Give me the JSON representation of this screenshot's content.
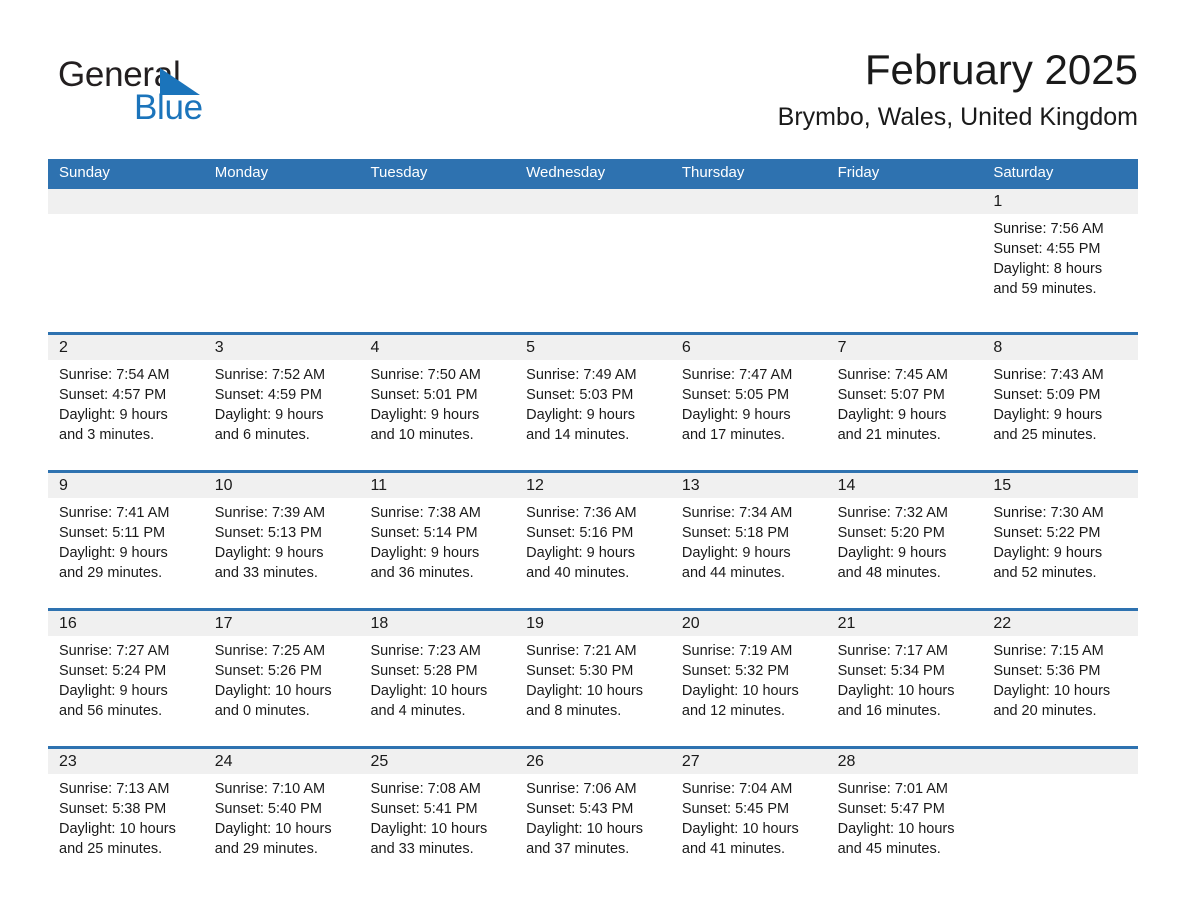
{
  "brand": {
    "name_part1": "General",
    "name_part2": "Blue",
    "logo_icon": "triangle-logo-icon",
    "accent_color": "#1b74bb"
  },
  "header": {
    "title": "February 2025",
    "subtitle": "Brymbo, Wales, United Kingdom"
  },
  "theme": {
    "header_blue": "#2e72b0",
    "datebar_gray": "#f0f0f0",
    "text_color": "#1a1a1a"
  },
  "weekdays": [
    "Sunday",
    "Monday",
    "Tuesday",
    "Wednesday",
    "Thursday",
    "Friday",
    "Saturday"
  ],
  "weeks": [
    {
      "days": [
        {
          "num": "",
          "sunrise": "",
          "sunset": "",
          "daylight1": "",
          "daylight2": ""
        },
        {
          "num": "",
          "sunrise": "",
          "sunset": "",
          "daylight1": "",
          "daylight2": ""
        },
        {
          "num": "",
          "sunrise": "",
          "sunset": "",
          "daylight1": "",
          "daylight2": ""
        },
        {
          "num": "",
          "sunrise": "",
          "sunset": "",
          "daylight1": "",
          "daylight2": ""
        },
        {
          "num": "",
          "sunrise": "",
          "sunset": "",
          "daylight1": "",
          "daylight2": ""
        },
        {
          "num": "",
          "sunrise": "",
          "sunset": "",
          "daylight1": "",
          "daylight2": ""
        },
        {
          "num": "1",
          "sunrise": "Sunrise: 7:56 AM",
          "sunset": "Sunset: 4:55 PM",
          "daylight1": "Daylight: 8 hours",
          "daylight2": "and 59 minutes."
        }
      ]
    },
    {
      "days": [
        {
          "num": "2",
          "sunrise": "Sunrise: 7:54 AM",
          "sunset": "Sunset: 4:57 PM",
          "daylight1": "Daylight: 9 hours",
          "daylight2": "and 3 minutes."
        },
        {
          "num": "3",
          "sunrise": "Sunrise: 7:52 AM",
          "sunset": "Sunset: 4:59 PM",
          "daylight1": "Daylight: 9 hours",
          "daylight2": "and 6 minutes."
        },
        {
          "num": "4",
          "sunrise": "Sunrise: 7:50 AM",
          "sunset": "Sunset: 5:01 PM",
          "daylight1": "Daylight: 9 hours",
          "daylight2": "and 10 minutes."
        },
        {
          "num": "5",
          "sunrise": "Sunrise: 7:49 AM",
          "sunset": "Sunset: 5:03 PM",
          "daylight1": "Daylight: 9 hours",
          "daylight2": "and 14 minutes."
        },
        {
          "num": "6",
          "sunrise": "Sunrise: 7:47 AM",
          "sunset": "Sunset: 5:05 PM",
          "daylight1": "Daylight: 9 hours",
          "daylight2": "and 17 minutes."
        },
        {
          "num": "7",
          "sunrise": "Sunrise: 7:45 AM",
          "sunset": "Sunset: 5:07 PM",
          "daylight1": "Daylight: 9 hours",
          "daylight2": "and 21 minutes."
        },
        {
          "num": "8",
          "sunrise": "Sunrise: 7:43 AM",
          "sunset": "Sunset: 5:09 PM",
          "daylight1": "Daylight: 9 hours",
          "daylight2": "and 25 minutes."
        }
      ]
    },
    {
      "days": [
        {
          "num": "9",
          "sunrise": "Sunrise: 7:41 AM",
          "sunset": "Sunset: 5:11 PM",
          "daylight1": "Daylight: 9 hours",
          "daylight2": "and 29 minutes."
        },
        {
          "num": "10",
          "sunrise": "Sunrise: 7:39 AM",
          "sunset": "Sunset: 5:13 PM",
          "daylight1": "Daylight: 9 hours",
          "daylight2": "and 33 minutes."
        },
        {
          "num": "11",
          "sunrise": "Sunrise: 7:38 AM",
          "sunset": "Sunset: 5:14 PM",
          "daylight1": "Daylight: 9 hours",
          "daylight2": "and 36 minutes."
        },
        {
          "num": "12",
          "sunrise": "Sunrise: 7:36 AM",
          "sunset": "Sunset: 5:16 PM",
          "daylight1": "Daylight: 9 hours",
          "daylight2": "and 40 minutes."
        },
        {
          "num": "13",
          "sunrise": "Sunrise: 7:34 AM",
          "sunset": "Sunset: 5:18 PM",
          "daylight1": "Daylight: 9 hours",
          "daylight2": "and 44 minutes."
        },
        {
          "num": "14",
          "sunrise": "Sunrise: 7:32 AM",
          "sunset": "Sunset: 5:20 PM",
          "daylight1": "Daylight: 9 hours",
          "daylight2": "and 48 minutes."
        },
        {
          "num": "15",
          "sunrise": "Sunrise: 7:30 AM",
          "sunset": "Sunset: 5:22 PM",
          "daylight1": "Daylight: 9 hours",
          "daylight2": "and 52 minutes."
        }
      ]
    },
    {
      "days": [
        {
          "num": "16",
          "sunrise": "Sunrise: 7:27 AM",
          "sunset": "Sunset: 5:24 PM",
          "daylight1": "Daylight: 9 hours",
          "daylight2": "and 56 minutes."
        },
        {
          "num": "17",
          "sunrise": "Sunrise: 7:25 AM",
          "sunset": "Sunset: 5:26 PM",
          "daylight1": "Daylight: 10 hours",
          "daylight2": "and 0 minutes."
        },
        {
          "num": "18",
          "sunrise": "Sunrise: 7:23 AM",
          "sunset": "Sunset: 5:28 PM",
          "daylight1": "Daylight: 10 hours",
          "daylight2": "and 4 minutes."
        },
        {
          "num": "19",
          "sunrise": "Sunrise: 7:21 AM",
          "sunset": "Sunset: 5:30 PM",
          "daylight1": "Daylight: 10 hours",
          "daylight2": "and 8 minutes."
        },
        {
          "num": "20",
          "sunrise": "Sunrise: 7:19 AM",
          "sunset": "Sunset: 5:32 PM",
          "daylight1": "Daylight: 10 hours",
          "daylight2": "and 12 minutes."
        },
        {
          "num": "21",
          "sunrise": "Sunrise: 7:17 AM",
          "sunset": "Sunset: 5:34 PM",
          "daylight1": "Daylight: 10 hours",
          "daylight2": "and 16 minutes."
        },
        {
          "num": "22",
          "sunrise": "Sunrise: 7:15 AM",
          "sunset": "Sunset: 5:36 PM",
          "daylight1": "Daylight: 10 hours",
          "daylight2": "and 20 minutes."
        }
      ]
    },
    {
      "days": [
        {
          "num": "23",
          "sunrise": "Sunrise: 7:13 AM",
          "sunset": "Sunset: 5:38 PM",
          "daylight1": "Daylight: 10 hours",
          "daylight2": "and 25 minutes."
        },
        {
          "num": "24",
          "sunrise": "Sunrise: 7:10 AM",
          "sunset": "Sunset: 5:40 PM",
          "daylight1": "Daylight: 10 hours",
          "daylight2": "and 29 minutes."
        },
        {
          "num": "25",
          "sunrise": "Sunrise: 7:08 AM",
          "sunset": "Sunset: 5:41 PM",
          "daylight1": "Daylight: 10 hours",
          "daylight2": "and 33 minutes."
        },
        {
          "num": "26",
          "sunrise": "Sunrise: 7:06 AM",
          "sunset": "Sunset: 5:43 PM",
          "daylight1": "Daylight: 10 hours",
          "daylight2": "and 37 minutes."
        },
        {
          "num": "27",
          "sunrise": "Sunrise: 7:04 AM",
          "sunset": "Sunset: 5:45 PM",
          "daylight1": "Daylight: 10 hours",
          "daylight2": "and 41 minutes."
        },
        {
          "num": "28",
          "sunrise": "Sunrise: 7:01 AM",
          "sunset": "Sunset: 5:47 PM",
          "daylight1": "Daylight: 10 hours",
          "daylight2": "and 45 minutes."
        },
        {
          "num": "",
          "sunrise": "",
          "sunset": "",
          "daylight1": "",
          "daylight2": ""
        }
      ]
    }
  ]
}
